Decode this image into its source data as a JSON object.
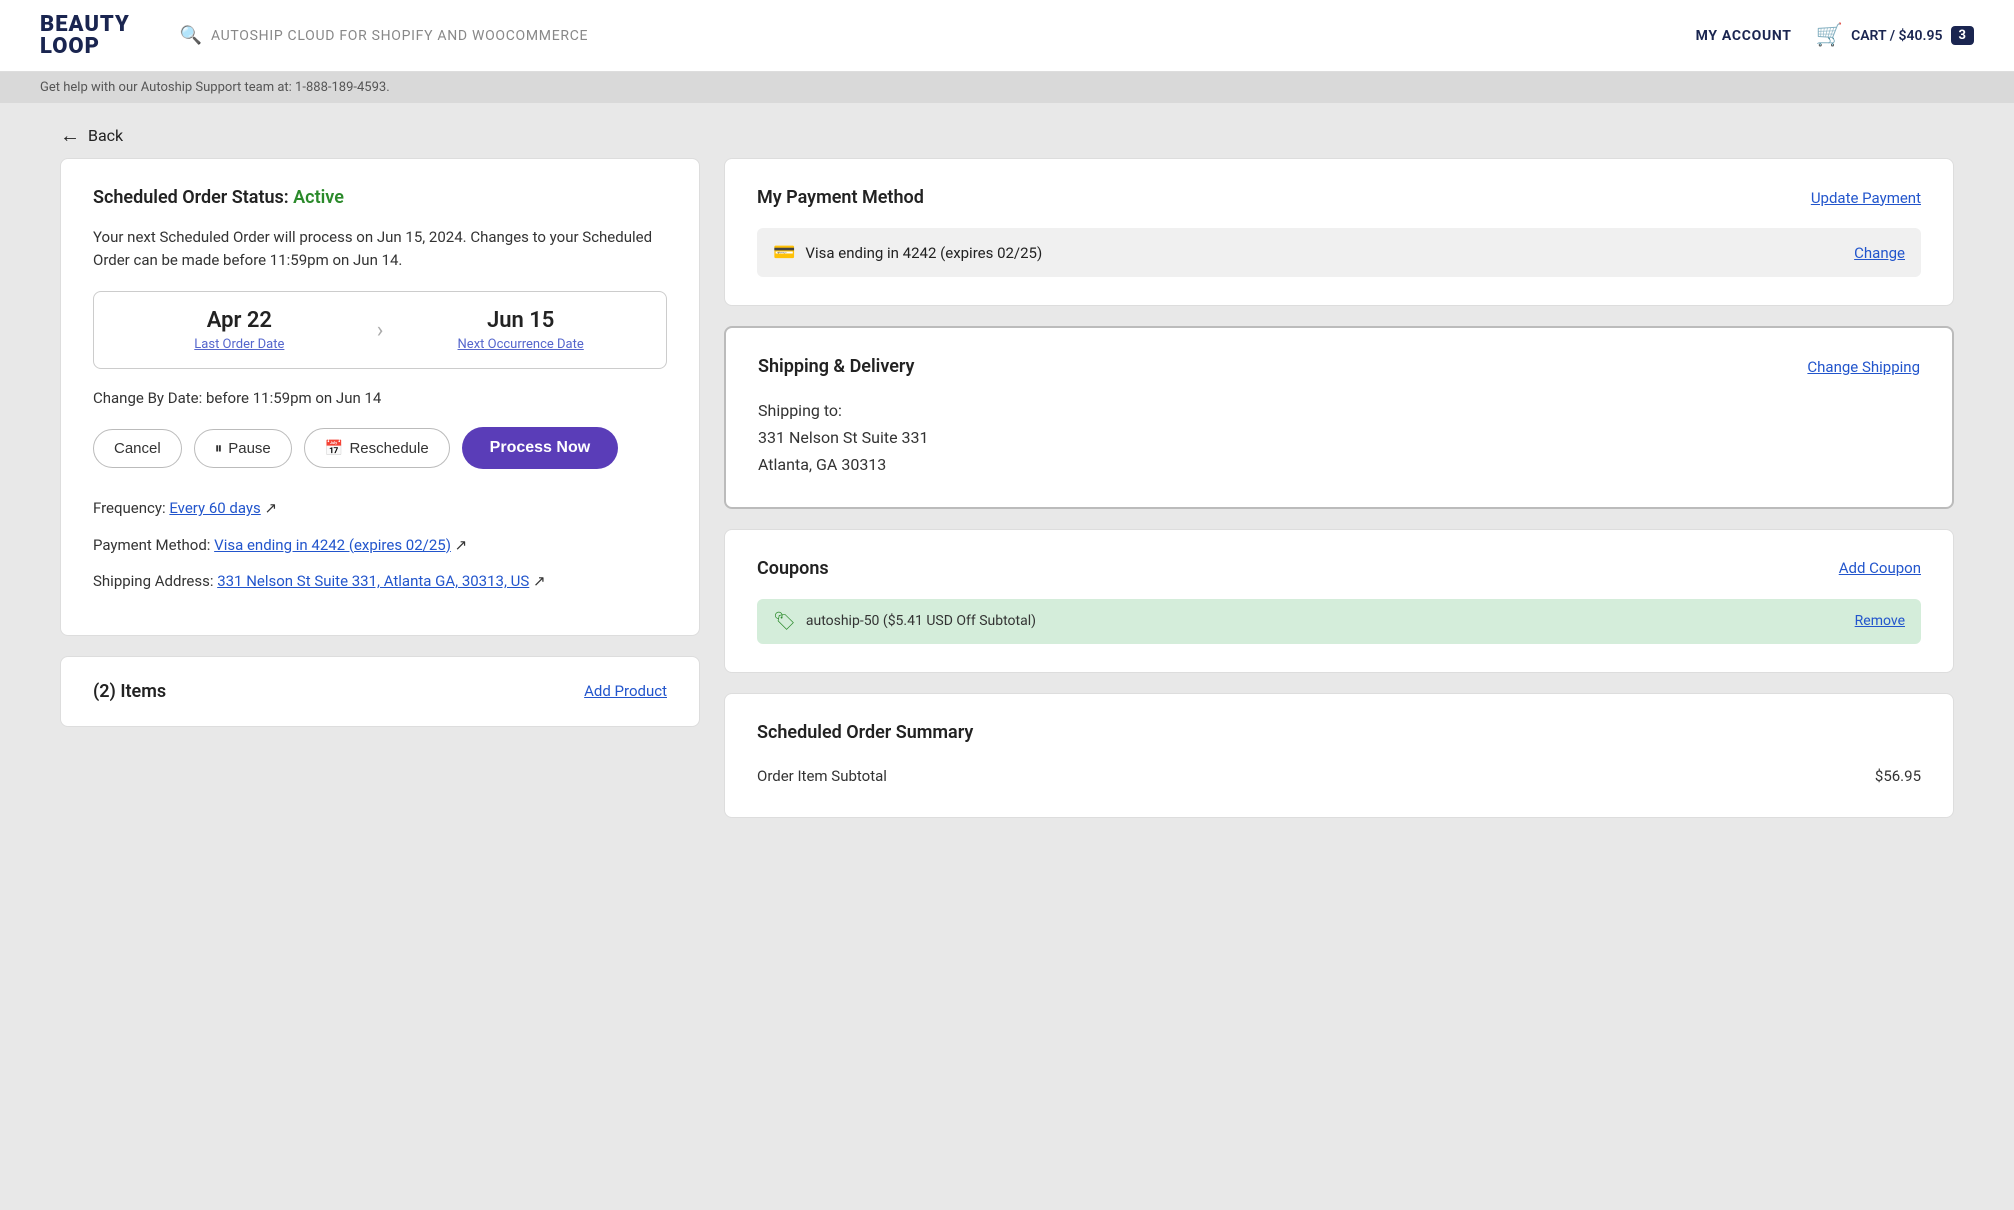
{
  "header": {
    "logo_line1": "BEAUTY",
    "logo_line2": "LOOP",
    "search_placeholder": "AUTOSHIP CLOUD FOR SHOPIFY AND WOOCOMMERCE",
    "my_account": "MY ACCOUNT",
    "cart_label": "CART / $40.95",
    "cart_count": "3"
  },
  "notice": {
    "text": "Get help with our Autoship Support team at: 1-888-189-4593."
  },
  "back": {
    "label": "Back"
  },
  "left": {
    "status_prefix": "Scheduled Order Status: ",
    "status_value": "Active",
    "info_text": "Your next Scheduled Order will process on Jun 15, 2024. Changes to your Scheduled Order can be made before 11:59pm on Jun 14.",
    "last_order_date": "Apr 22",
    "last_order_label": "Last Order Date",
    "next_occurrence_date": "Jun 15",
    "next_occurrence_label": "Next Occurrence Date",
    "change_by": "Change By Date: before 11:59pm on Jun 14",
    "btn_cancel": "Cancel",
    "btn_pause": "Pause",
    "btn_reschedule": "Reschedule",
    "btn_process": "Process Now",
    "frequency_prefix": "Frequency: ",
    "frequency_link": "Every 60 days",
    "payment_prefix": "Payment Method: ",
    "payment_link": "Visa ending in 4242 (expires 02/25)",
    "shipping_prefix": "Shipping Address: ",
    "shipping_link": "331 Nelson St Suite 331, Atlanta GA, 30313, US",
    "items_label": "(2) Items",
    "add_product": "Add Product"
  },
  "right": {
    "payment": {
      "title": "My Payment Method",
      "update_link": "Update Payment",
      "card_info": "Visa ending in 4242 (expires 02/25)",
      "change_link": "Change"
    },
    "shipping": {
      "title": "Shipping & Delivery",
      "change_link": "Change Shipping",
      "shipping_to": "Shipping to:",
      "address_line1": "331 Nelson St Suite 331",
      "address_line2": "Atlanta, GA 30313"
    },
    "coupons": {
      "title": "Coupons",
      "add_link": "Add Coupon",
      "coupon_text": "autoship-50 ($5.41 USD Off Subtotal)",
      "remove_link": "Remove"
    },
    "summary": {
      "title": "Scheduled Order Summary",
      "order_item_label": "Order Item Subtotal",
      "order_item_value": "$56.95"
    }
  }
}
